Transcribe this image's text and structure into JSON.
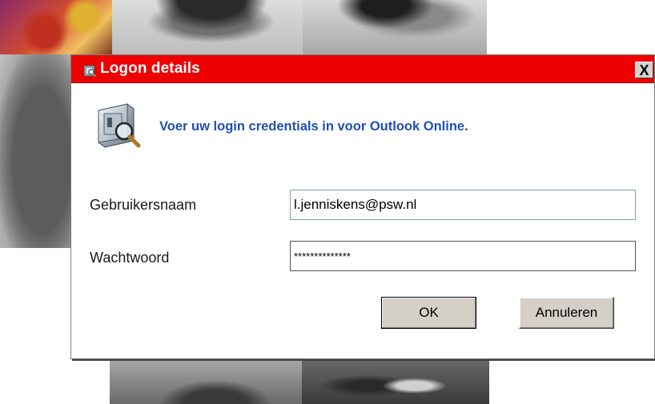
{
  "window": {
    "title": "Logon details",
    "close_label": "X"
  },
  "header": {
    "message": "Voer uw login credentials in voor Outlook Online.",
    "icon": "safe-search-icon"
  },
  "form": {
    "username_label": "Gebruikersnaam",
    "username_value": "l.jenniskens@psw.nl",
    "password_label": "Wachtwoord",
    "password_value": "**************"
  },
  "buttons": {
    "ok_label": "OK",
    "cancel_label": "Annuleren"
  },
  "colors": {
    "titlebar": "#ee0000",
    "header_text": "#1f4fb4",
    "button_face": "#d4d0c8"
  }
}
